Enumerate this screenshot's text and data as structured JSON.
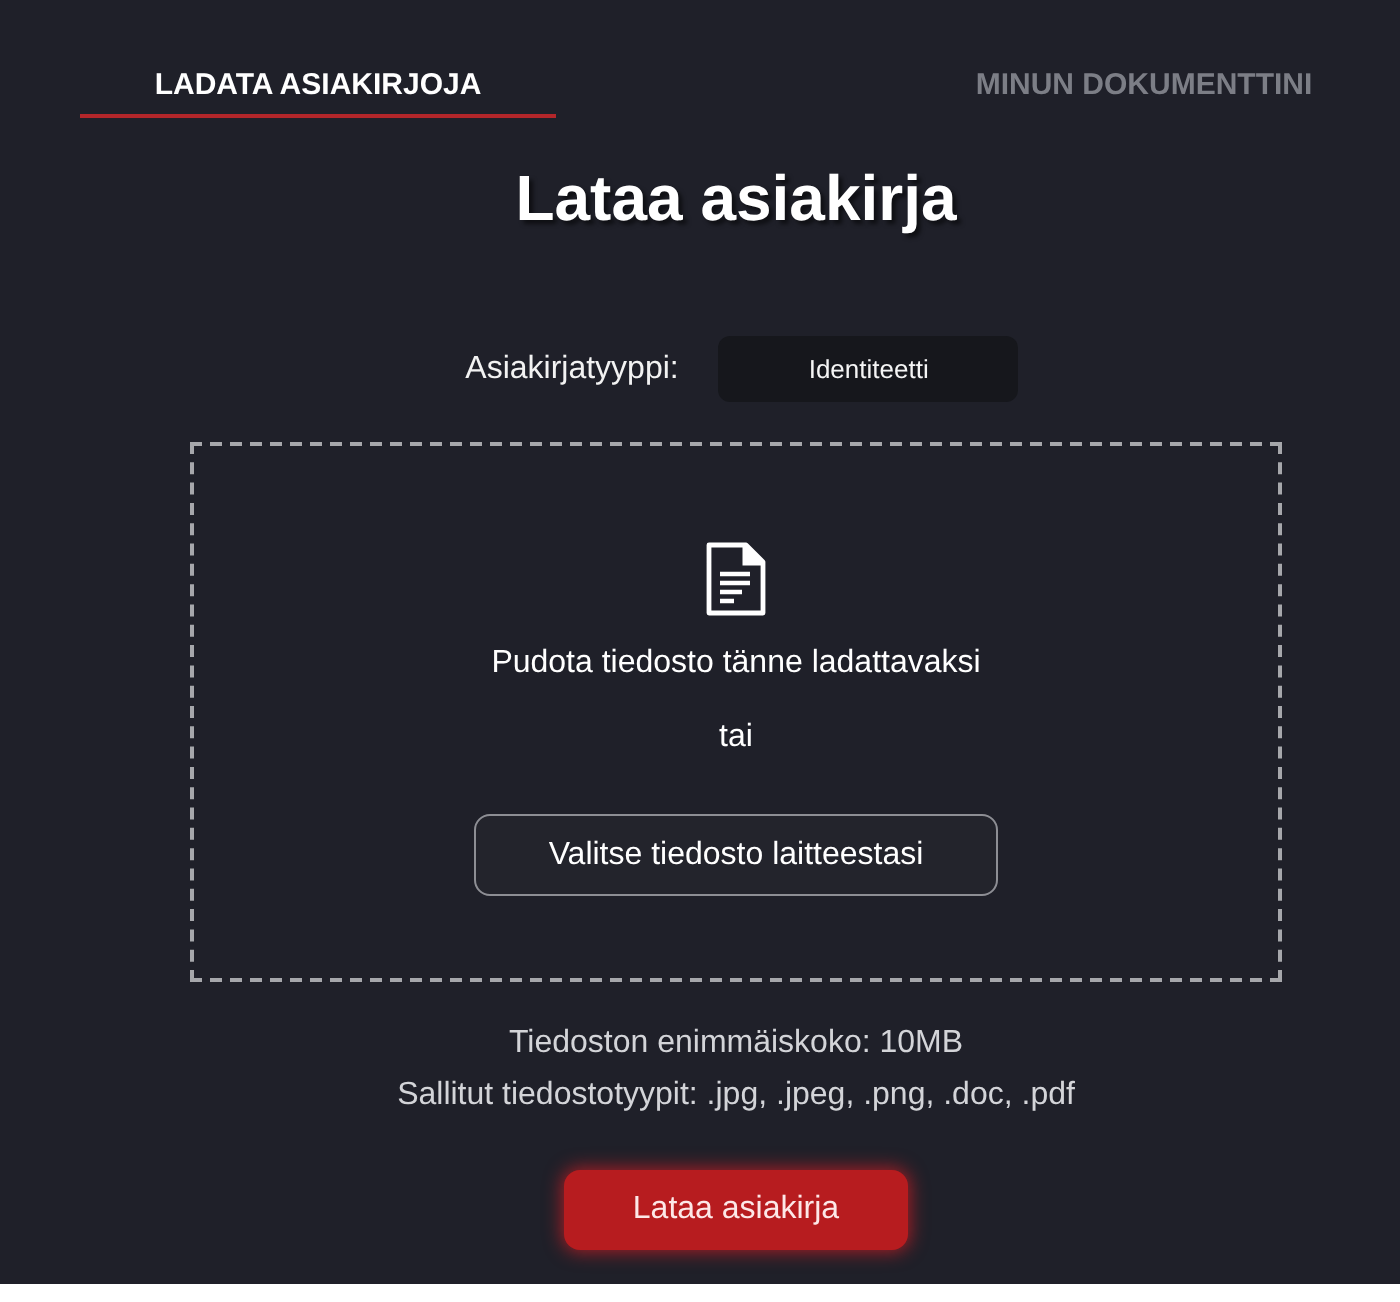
{
  "tabs": [
    {
      "label": "LADATA ASIAKIRJOJA",
      "selected": true
    },
    {
      "label": "MINUN DOKUMENTTINI",
      "selected": false
    }
  ],
  "title": "Lataa asiakirja",
  "document_type": {
    "label": "Asiakirjatyyppi:",
    "value": "Identiteetti"
  },
  "dropzone": {
    "prompt": "Pudota tiedosto tänne ladattavaksi",
    "separator": "tai",
    "button": "Valitse tiedosto laitteestasi"
  },
  "limits": [
    "Tiedoston enimmäiskoko: 10MB",
    "Sallitut tiedostotyypit: .jpg, .jpeg, .png, .doc, .pdf"
  ],
  "submit_button": "Lataa asiakirja"
}
